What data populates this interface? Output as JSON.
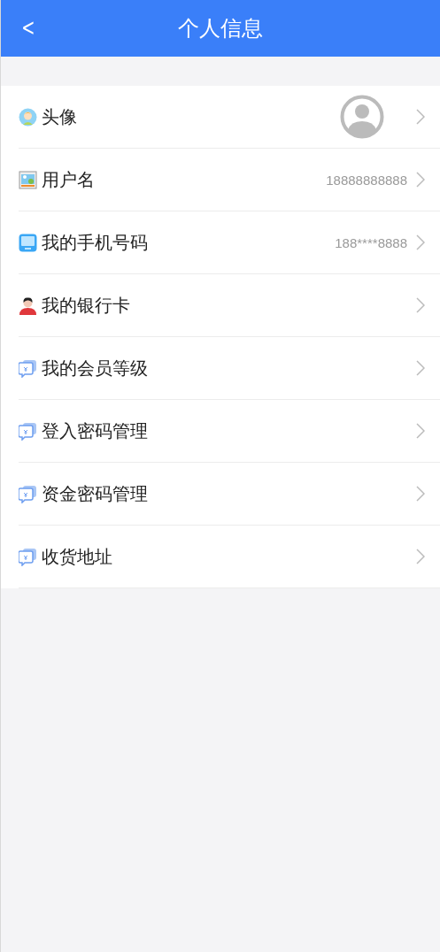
{
  "header": {
    "back": "<",
    "title": "个人信息"
  },
  "rows": [
    {
      "label": "头像",
      "kind": "avatar"
    },
    {
      "label": "用户名",
      "kind": "text",
      "value": "18888888888"
    },
    {
      "label": "我的手机号码",
      "kind": "text",
      "value": "188****8888"
    },
    {
      "label": "我的银行卡",
      "kind": "plain"
    },
    {
      "label": "我的会员等级",
      "kind": "plain"
    },
    {
      "label": "登入密码管理",
      "kind": "plain"
    },
    {
      "label": "资金密码管理",
      "kind": "plain"
    },
    {
      "label": "收货地址",
      "kind": "plain"
    }
  ]
}
